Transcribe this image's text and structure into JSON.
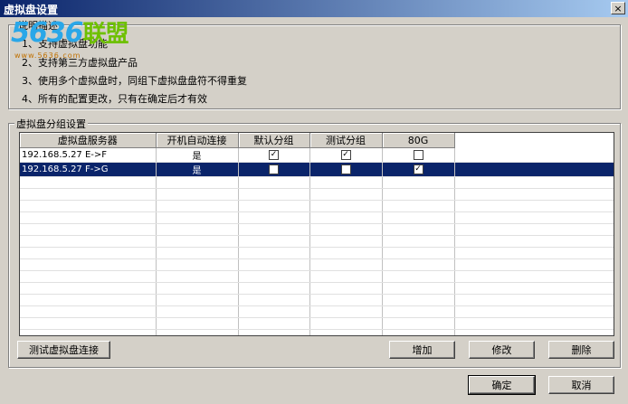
{
  "window": {
    "title": "虚拟盘设置",
    "close_glyph": "×"
  },
  "watermark": {
    "digits": "5636",
    "suffix": "联盟",
    "sub": "www.5636.com"
  },
  "description": {
    "label": "说明描述",
    "lines": [
      "1、支持虚拟盘功能",
      "2、支持第三方虚拟盘产品",
      "3、使用多个虚拟盘时，同组下虚拟盘盘符不得重复",
      "4、所有的配置更改，只有在确定后才有效"
    ]
  },
  "groups": {
    "label": "虚拟盘分组设置",
    "columns": [
      "虚拟盘服务器",
      "开机自动连接",
      "默认分组",
      "测试分组",
      "80G"
    ],
    "rows": [
      {
        "server": "192.168.5.27 E->F",
        "auto": "是",
        "checks": [
          true,
          true,
          false
        ],
        "selected": false
      },
      {
        "server": "192.168.5.27 F->G",
        "auto": "是",
        "checks": [
          false,
          false,
          true
        ],
        "selected": true
      }
    ]
  },
  "buttons": {
    "test": "测试虚拟盘连接",
    "add": "增加",
    "edit": "修改",
    "delete": "删除",
    "ok": "确定",
    "cancel": "取消"
  }
}
